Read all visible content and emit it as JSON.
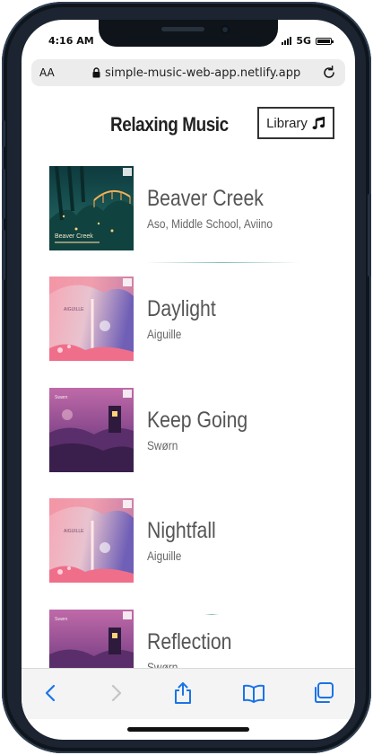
{
  "status_bar": {
    "time": "4:16 AM",
    "network": "5G"
  },
  "browser": {
    "aa_label": "AA",
    "url": "simple-music-web-app.netlify.app",
    "accent_color": "#1a73e8"
  },
  "header": {
    "title": "Relaxing Music",
    "library_label": "Library"
  },
  "songs": [
    {
      "name": "Beaver Creek",
      "artist": "Aso, Middle School, Aviino",
      "cover_text": "Beaver Creek"
    },
    {
      "name": "Daylight",
      "artist": "Aiguille",
      "cover_text": ""
    },
    {
      "name": "Keep Going",
      "artist": "Swørn",
      "cover_text": ""
    },
    {
      "name": "Nightfall",
      "artist": "Aiguille",
      "cover_text": ""
    },
    {
      "name": "Reflection",
      "artist": "Swørn",
      "cover_text": ""
    }
  ],
  "icons": {
    "back": "chevron-left-icon",
    "forward": "chevron-right-icon",
    "share": "share-icon",
    "bookmarks": "book-icon",
    "tabs": "tabs-icon",
    "library": "music-note-icon",
    "lock": "lock-icon",
    "reload": "reload-icon"
  }
}
